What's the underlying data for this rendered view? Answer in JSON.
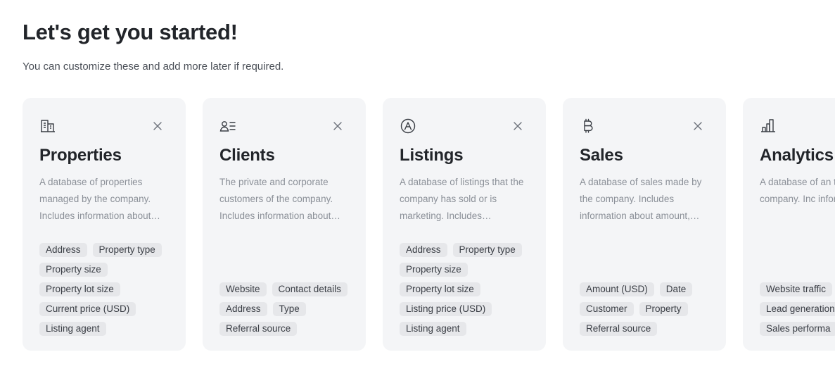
{
  "header": {
    "title": "Let's get you started!",
    "subtitle": "You can customize these and add more later if required."
  },
  "cards": [
    {
      "icon": "building-icon",
      "title": "Properties",
      "description": "A database of properties managed by the company. Includes information about…",
      "tags": [
        "Address",
        "Property type",
        "Property size",
        "Property lot size",
        "Current price (USD)",
        "Listing agent"
      ],
      "closable": true
    },
    {
      "icon": "contacts-icon",
      "title": "Clients",
      "description": "The private and corporate customers of the company. Includes information about…",
      "tags": [
        "Website",
        "Contact details",
        "Address",
        "Type",
        "Referral source"
      ],
      "closable": true
    },
    {
      "icon": "listing-icon",
      "title": "Listings",
      "description": "A database of listings that the company has sold or is marketing. Includes…",
      "tags": [
        "Address",
        "Property type",
        "Property size",
        "Property lot size",
        "Listing price (USD)",
        "Listing agent"
      ],
      "closable": true
    },
    {
      "icon": "bitcoin-icon",
      "title": "Sales",
      "description": "A database of sales made by the company. Includes information about amount,…",
      "tags": [
        "Amount (USD)",
        "Date",
        "Customer",
        "Property",
        "Referral source"
      ],
      "closable": true
    },
    {
      "icon": "bar-chart-icon",
      "title": "Analytics",
      "description": "A database of an the company. Inc information abou",
      "tags": [
        "Website traffic",
        "Lead generation",
        "Sales performa"
      ],
      "closable": false
    }
  ]
}
